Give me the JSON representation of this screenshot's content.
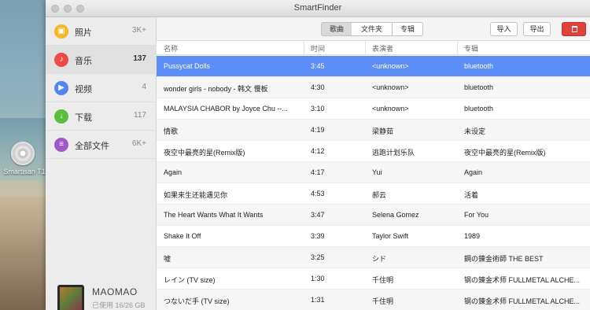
{
  "desktop": {
    "device_label": "Smartisan T1"
  },
  "window": {
    "title": "SmartFinder"
  },
  "sidebar": {
    "items": [
      {
        "label": "照片",
        "count": "3K+",
        "color": "#f5b824",
        "glyph": "▣"
      },
      {
        "label": "音乐",
        "count": "137",
        "color": "#ef4b47",
        "glyph": "♪"
      },
      {
        "label": "视频",
        "count": "4",
        "color": "#4f86f0",
        "glyph": "▶"
      },
      {
        "label": "下载",
        "count": "117",
        "color": "#5cbd3a",
        "glyph": "↓"
      },
      {
        "label": "全部文件",
        "count": "6K+",
        "color": "#a057c9",
        "glyph": "≡"
      }
    ],
    "device": {
      "name": "MAOMAO",
      "usage": "已使用 16/26 GB"
    }
  },
  "toolbar": {
    "tabs": [
      "歌曲",
      "文件夹",
      "专辑"
    ],
    "import_label": "导入",
    "export_label": "导出",
    "delete_color": "#e0413d"
  },
  "table": {
    "headers": [
      "名称",
      "时间",
      "表演者",
      "专辑"
    ],
    "rows": [
      {
        "name": "Pussycat Dolls",
        "time": "3:45",
        "artist": "<unknown>",
        "album": "bluetooth"
      },
      {
        "name": "wonder girls - nobody - 韩文 慢板",
        "time": "4:30",
        "artist": "<unknown>",
        "album": "bluetooth"
      },
      {
        "name": "MALAYSIA CHABOR by Joyce Chu --...",
        "time": "3:10",
        "artist": "<unknown>",
        "album": "bluetooth"
      },
      {
        "name": "情歌",
        "time": "4:19",
        "artist": "梁静茹",
        "album": "未设定"
      },
      {
        "name": "夜空中最亮的星(Remix版)",
        "time": "4:12",
        "artist": "逃跑计划乐队",
        "album": "夜空中最亮的星(Remix版)"
      },
      {
        "name": "Again",
        "time": "4:17",
        "artist": "Yui",
        "album": "Again"
      },
      {
        "name": "如果来生还能遇见你",
        "time": "4:53",
        "artist": "郝云",
        "album": "活着"
      },
      {
        "name": "The Heart Wants What It Wants",
        "time": "3:47",
        "artist": "Selena Gomez",
        "album": "For You"
      },
      {
        "name": "Shake It Off",
        "time": "3:39",
        "artist": "Taylor Swift",
        "album": "1989"
      },
      {
        "name": "嘘",
        "time": "3:25",
        "artist": "シド",
        "album": "鋼の錬金術師 THE BEST"
      },
      {
        "name": "レイン (TV size)",
        "time": "1:30",
        "artist": "千住明",
        "album": "钢の錬金术师 FULLMETAL ALCHE..."
      },
      {
        "name": "つないだ手 (TV size)",
        "time": "1:31",
        "artist": "千住明",
        "album": "钢の錬金术师 FULLMETAL ALCHE..."
      }
    ],
    "selected_color": "#5b8ef7"
  }
}
